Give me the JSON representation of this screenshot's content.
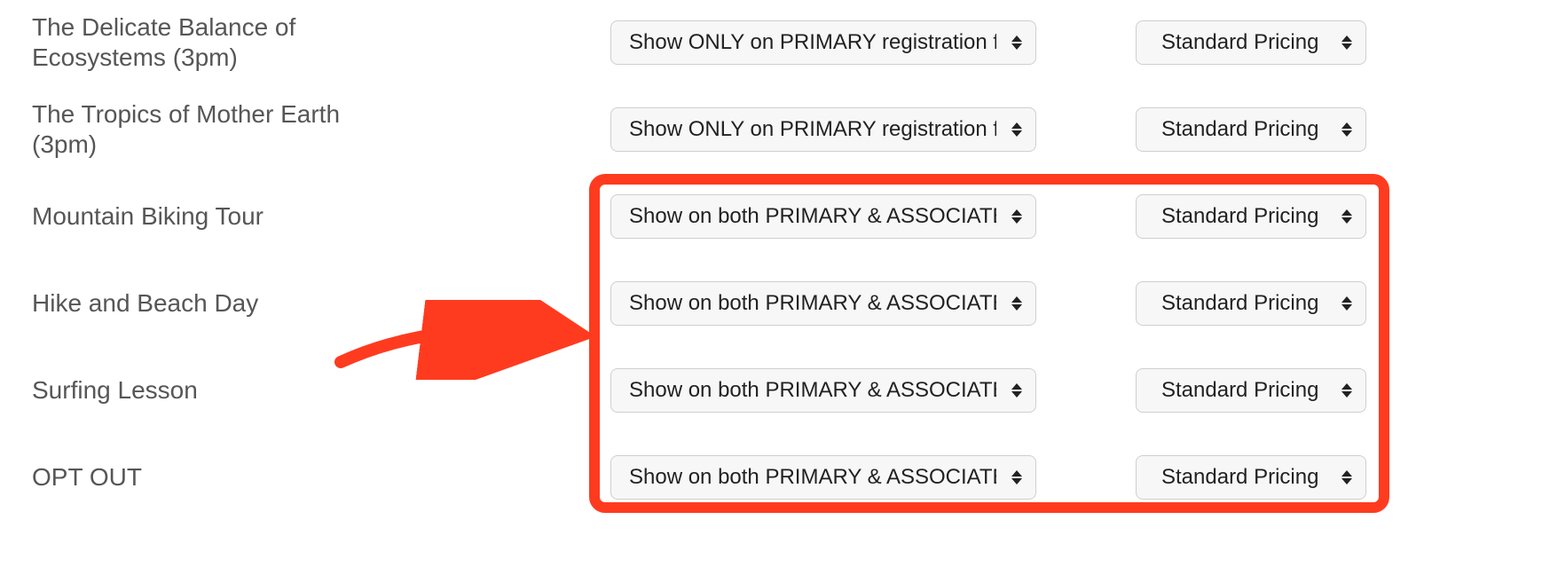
{
  "colors": {
    "highlight": "#ff3b1f"
  },
  "select_options": {
    "visibility": {
      "primary_only": "Show ONLY on PRIMARY registration form",
      "both": "Show on both PRIMARY & ASSOCIATE forms"
    },
    "pricing": {
      "standard": "Standard Pricing"
    }
  },
  "rows": [
    {
      "label": "The Delicate Balance of Ecosystems (3pm)",
      "visibility": "Show ONLY on PRIMARY registration form",
      "pricing": "Standard Pricing"
    },
    {
      "label": "The Tropics of Mother Earth (3pm)",
      "visibility": "Show ONLY on PRIMARY registration form",
      "pricing": "Standard Pricing"
    },
    {
      "label": "Mountain Biking Tour",
      "visibility": "Show on both PRIMARY & ASSOCIATE forms",
      "pricing": "Standard Pricing"
    },
    {
      "label": "Hike and Beach Day",
      "visibility": "Show on both PRIMARY & ASSOCIATE forms",
      "pricing": "Standard Pricing"
    },
    {
      "label": "Surfing Lesson",
      "visibility": "Show on both PRIMARY & ASSOCIATE forms",
      "pricing": "Standard Pricing"
    },
    {
      "label": "OPT OUT",
      "visibility": "Show on both PRIMARY & ASSOCIATE forms",
      "pricing": "Standard Pricing"
    }
  ]
}
